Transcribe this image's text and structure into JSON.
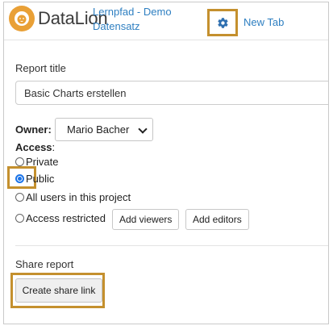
{
  "header": {
    "logo_text": "DataLion",
    "project_link_line1": "Lernpfad - Demo",
    "project_link_line2": "Datensatz",
    "settings_icon": "gear-icon",
    "new_tab_label": "New Tab"
  },
  "form": {
    "report_title_label": "Report title",
    "report_title_value": "Basic Charts erstellen",
    "owner_label": "Owner:",
    "owner_value": "Mario Bacher",
    "access_label": "Access",
    "access_colon": ":",
    "access_options": [
      {
        "label": "Private",
        "checked": false
      },
      {
        "label": "Public",
        "checked": true
      },
      {
        "label": "All users in this project",
        "checked": false
      },
      {
        "label": "Access restricted",
        "checked": false
      }
    ],
    "add_viewers_label": "Add viewers",
    "add_editors_label": "Add editors",
    "share_report_label": "Share report",
    "create_share_link_label": "Create share link"
  },
  "colors": {
    "link": "#2e7fc1",
    "highlight": "#c4902e",
    "logo": "#e9a036",
    "radio_checked": "#1a73e8"
  }
}
